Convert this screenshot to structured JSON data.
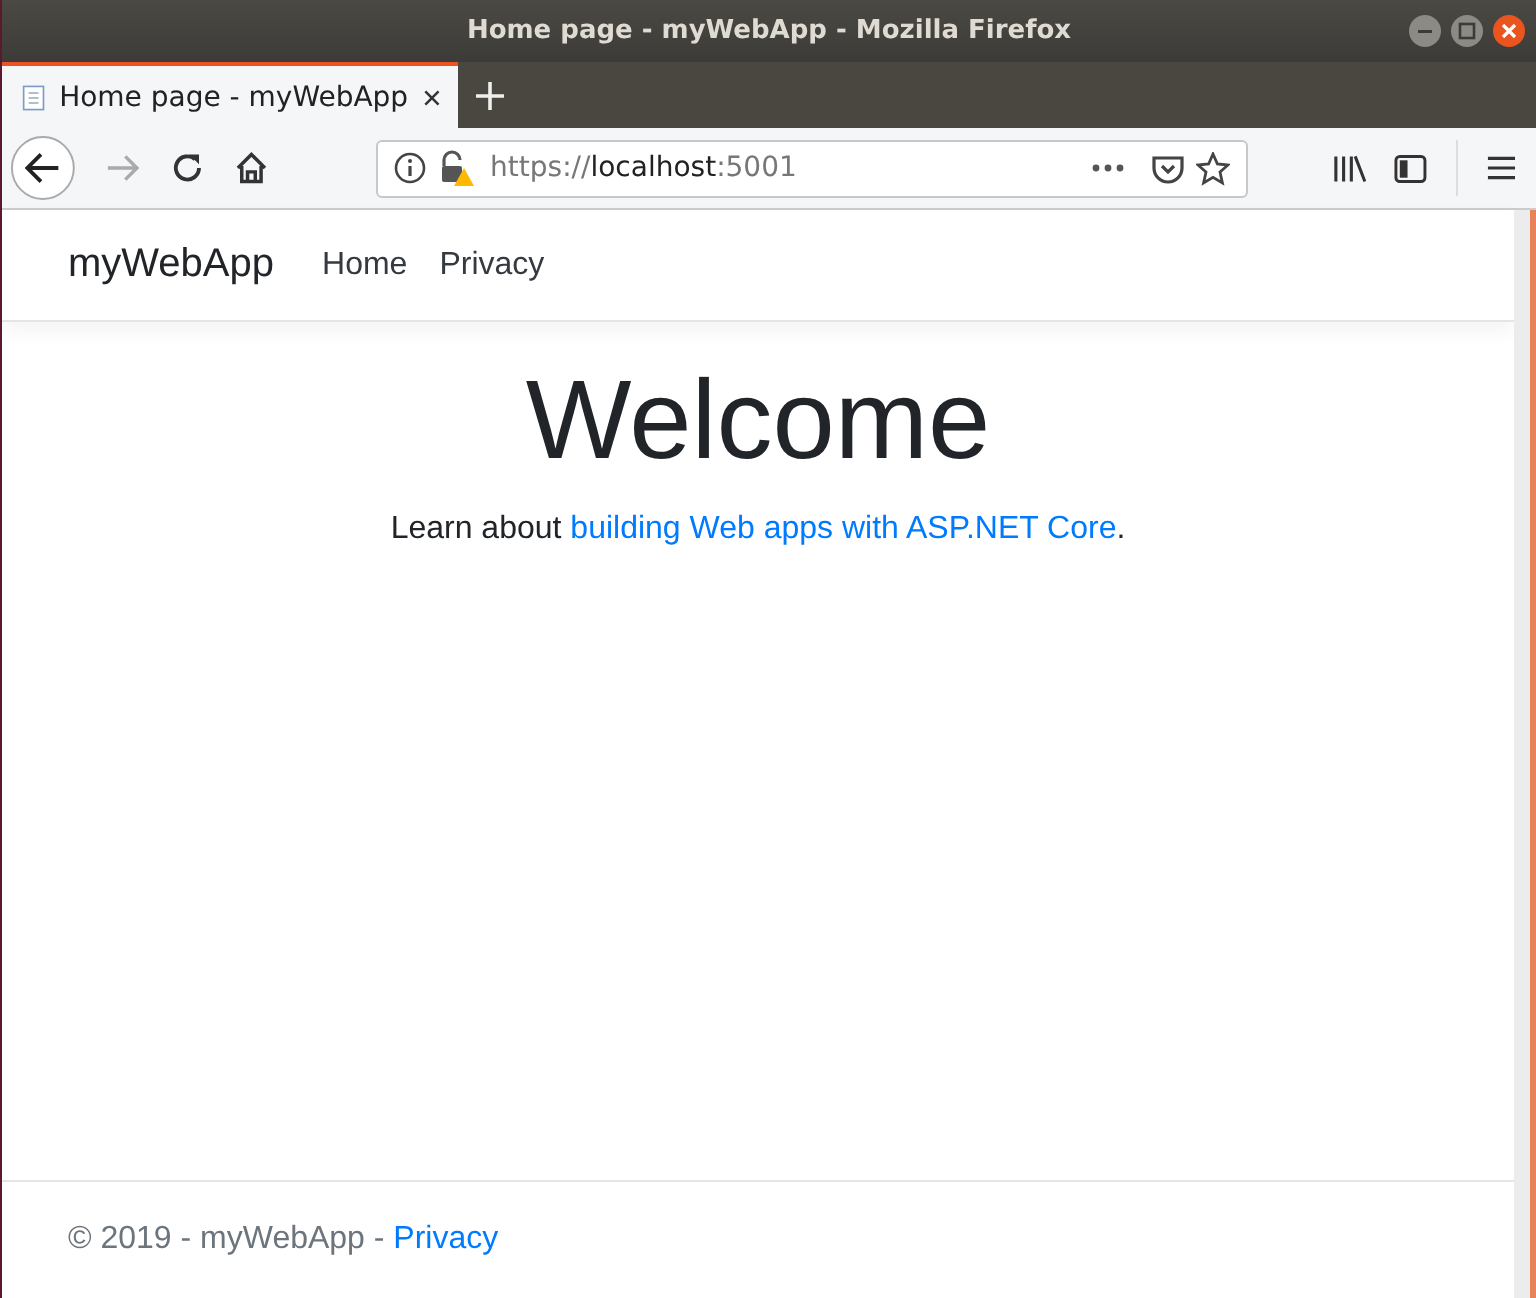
{
  "window": {
    "title": "Home page - myWebApp - Mozilla Firefox"
  },
  "tabs": [
    {
      "label": "Home page - myWebApp",
      "selected": true
    }
  ],
  "toolbar": {
    "forward_disabled": true
  },
  "address_bar": {
    "scheme": "https://",
    "host": "localhost",
    "port": ":5001"
  },
  "navbar": {
    "brand": "myWebApp",
    "links": [
      "Home",
      "Privacy"
    ]
  },
  "main": {
    "heading": "Welcome",
    "text_before": "Learn about ",
    "link": "building Web apps with ASP.NET Core",
    "text_after": "."
  },
  "footer": {
    "text": "© 2019 - myWebApp - ",
    "link": "Privacy"
  }
}
